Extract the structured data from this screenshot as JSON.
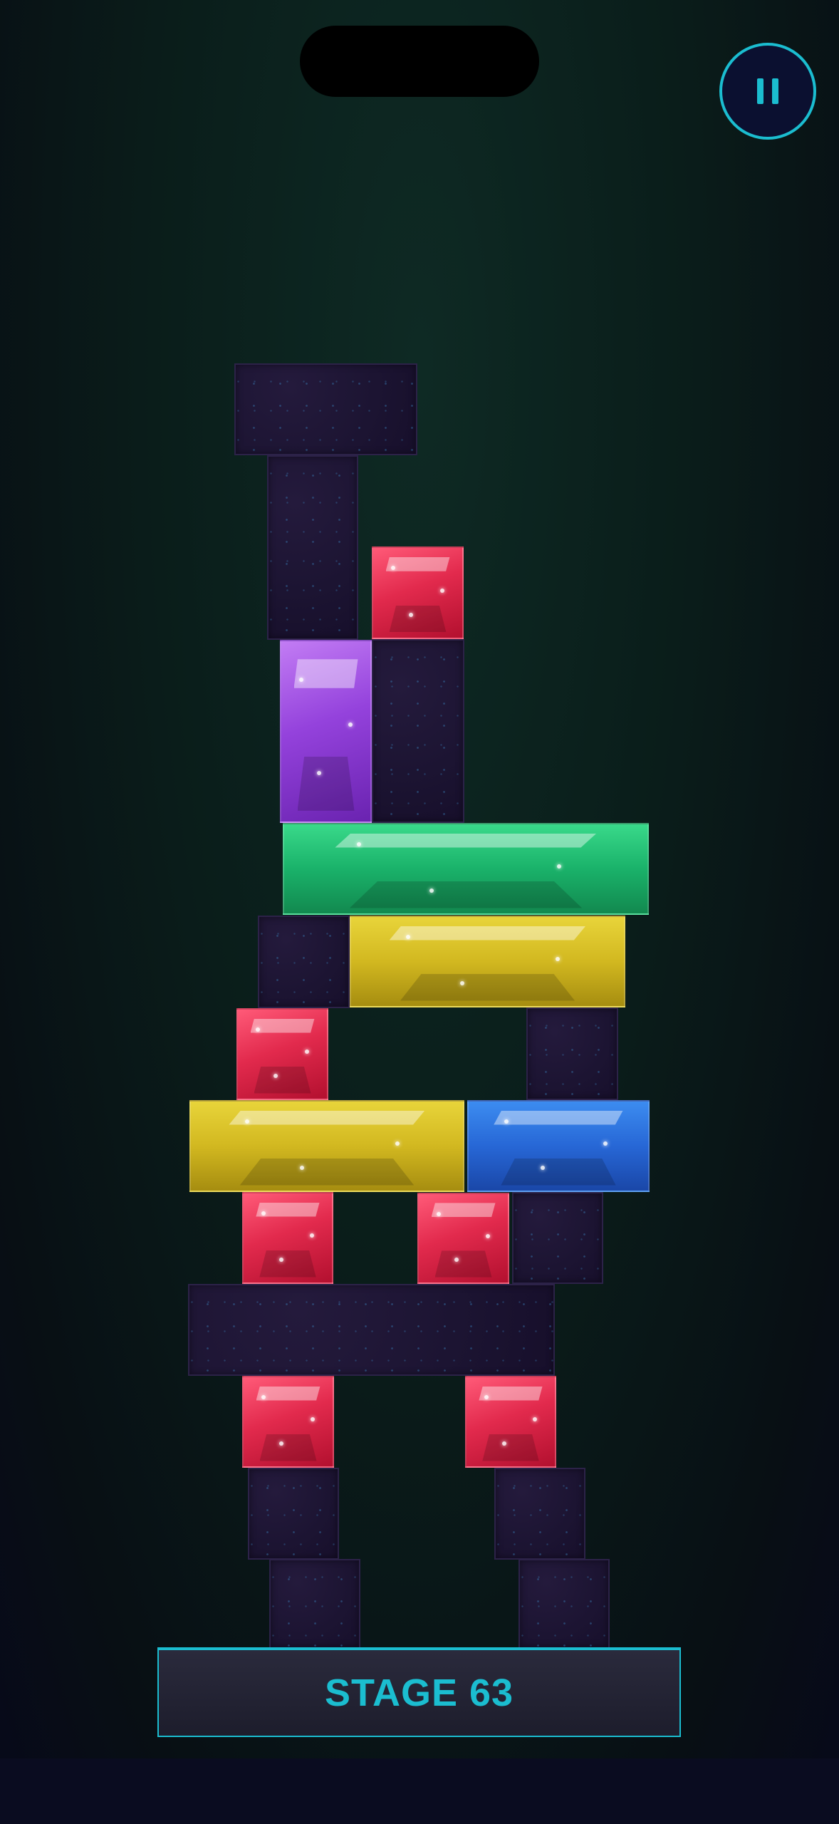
{
  "stage": {
    "label": "STAGE 63"
  },
  "controls": {
    "pause_icon": "pause-icon"
  },
  "colors": {
    "accent": "#1bbdd0",
    "stone": "#1c1432",
    "red": "#e22a4d",
    "purple": "#9442dc",
    "green": "#1ab26a",
    "yellow": "#d2b820",
    "blue": "#2767d6"
  },
  "blocks": [
    {
      "type": "stone"
    },
    {
      "type": "stone"
    },
    {
      "type": "gem",
      "color": "red"
    },
    {
      "type": "gem",
      "color": "purple"
    },
    {
      "type": "stone"
    },
    {
      "type": "gem",
      "color": "green"
    },
    {
      "type": "stone"
    },
    {
      "type": "gem",
      "color": "yellow"
    },
    {
      "type": "gem",
      "color": "red"
    },
    {
      "type": "stone"
    },
    {
      "type": "gem",
      "color": "yellow"
    },
    {
      "type": "gem",
      "color": "blue"
    },
    {
      "type": "gem",
      "color": "red"
    },
    {
      "type": "gem",
      "color": "red"
    },
    {
      "type": "stone"
    },
    {
      "type": "stone"
    },
    {
      "type": "gem",
      "color": "red"
    },
    {
      "type": "gem",
      "color": "red"
    },
    {
      "type": "stone"
    },
    {
      "type": "stone"
    },
    {
      "type": "stone"
    },
    {
      "type": "stone"
    }
  ]
}
